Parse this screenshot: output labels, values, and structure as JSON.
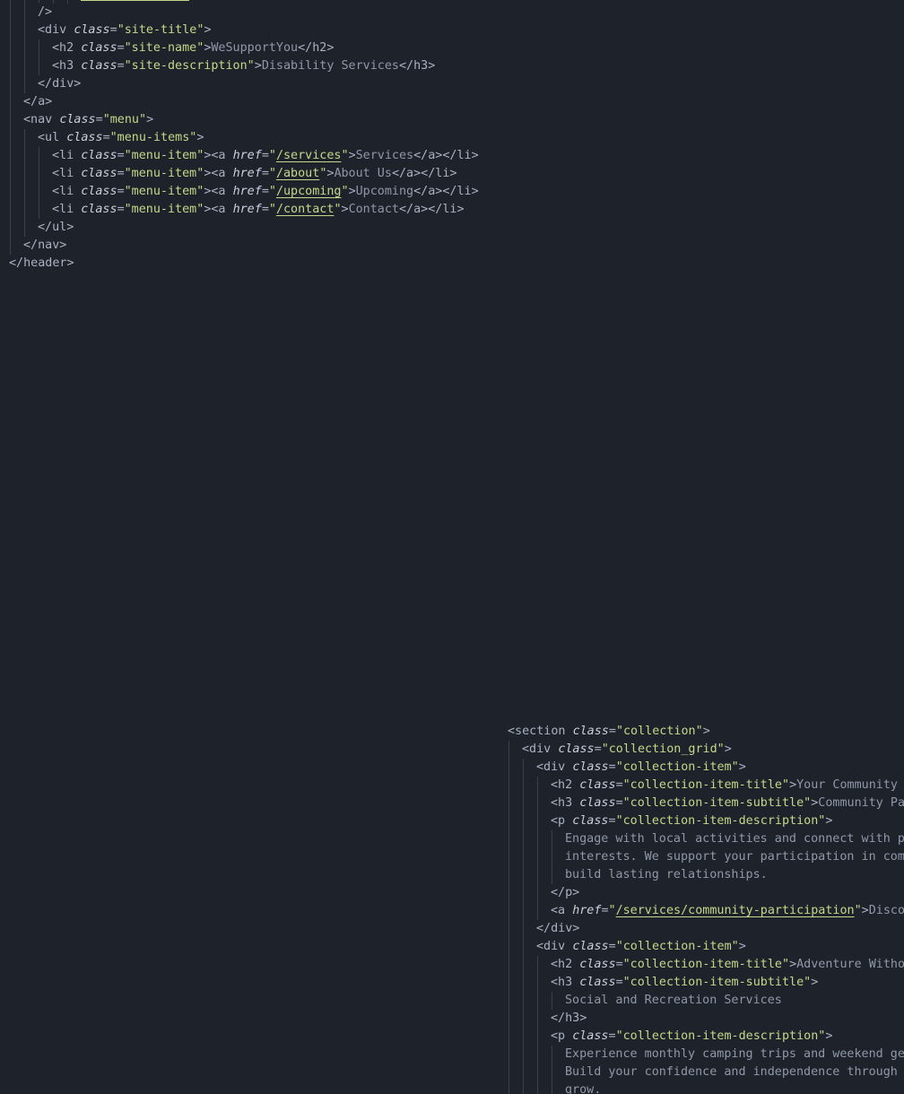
{
  "header_code": [
    {
      "indent": 5,
      "tokens": [
        {
          "k": "u",
          "v": "images/logo.svg"
        }
      ]
    },
    {
      "indent": 2,
      "tokens": [
        {
          "k": "t",
          "v": "/>"
        }
      ]
    },
    {
      "indent": 2,
      "tokens": [
        {
          "k": "t",
          "v": "<div "
        },
        {
          "k": "a",
          "v": "class"
        },
        {
          "k": "e",
          "v": "="
        },
        {
          "k": "s",
          "v": "\"site-title\""
        },
        {
          "k": "t",
          "v": ">"
        }
      ]
    },
    {
      "indent": 3,
      "tokens": [
        {
          "k": "t",
          "v": "<h2 "
        },
        {
          "k": "a",
          "v": "class"
        },
        {
          "k": "e",
          "v": "="
        },
        {
          "k": "s",
          "v": "\"site-name\""
        },
        {
          "k": "t",
          "v": ">"
        },
        {
          "k": "x",
          "v": "WeSupportYou"
        },
        {
          "k": "t",
          "v": "</h2>"
        }
      ]
    },
    {
      "indent": 3,
      "tokens": [
        {
          "k": "t",
          "v": "<h3 "
        },
        {
          "k": "a",
          "v": "class"
        },
        {
          "k": "e",
          "v": "="
        },
        {
          "k": "s",
          "v": "\"site-description\""
        },
        {
          "k": "t",
          "v": ">"
        },
        {
          "k": "x",
          "v": "Disability Services"
        },
        {
          "k": "t",
          "v": "</h3>"
        }
      ]
    },
    {
      "indent": 2,
      "tokens": [
        {
          "k": "t",
          "v": "</div>"
        }
      ]
    },
    {
      "indent": 1,
      "tokens": [
        {
          "k": "t",
          "v": "</a>"
        }
      ]
    },
    {
      "indent": 1,
      "tokens": [
        {
          "k": "t",
          "v": "<nav "
        },
        {
          "k": "a",
          "v": "class"
        },
        {
          "k": "e",
          "v": "="
        },
        {
          "k": "s",
          "v": "\"menu\""
        },
        {
          "k": "t",
          "v": ">"
        }
      ]
    },
    {
      "indent": 2,
      "tokens": [
        {
          "k": "t",
          "v": "<ul "
        },
        {
          "k": "a",
          "v": "class"
        },
        {
          "k": "e",
          "v": "="
        },
        {
          "k": "s",
          "v": "\"menu-items\""
        },
        {
          "k": "t",
          "v": ">"
        }
      ]
    },
    {
      "indent": 3,
      "tokens": [
        {
          "k": "t",
          "v": "<li "
        },
        {
          "k": "a",
          "v": "class"
        },
        {
          "k": "e",
          "v": "="
        },
        {
          "k": "s",
          "v": "\"menu-item\""
        },
        {
          "k": "t",
          "v": "><a "
        },
        {
          "k": "a",
          "v": "href"
        },
        {
          "k": "e",
          "v": "="
        },
        {
          "k": "s",
          "v": "\""
        },
        {
          "k": "u",
          "v": "/services"
        },
        {
          "k": "s",
          "v": "\""
        },
        {
          "k": "t",
          "v": ">"
        },
        {
          "k": "x",
          "v": "Services"
        },
        {
          "k": "t",
          "v": "</a></li>"
        }
      ]
    },
    {
      "indent": 3,
      "tokens": [
        {
          "k": "t",
          "v": "<li "
        },
        {
          "k": "a",
          "v": "class"
        },
        {
          "k": "e",
          "v": "="
        },
        {
          "k": "s",
          "v": "\"menu-item\""
        },
        {
          "k": "t",
          "v": "><a "
        },
        {
          "k": "a",
          "v": "href"
        },
        {
          "k": "e",
          "v": "="
        },
        {
          "k": "s",
          "v": "\""
        },
        {
          "k": "u",
          "v": "/about"
        },
        {
          "k": "s",
          "v": "\""
        },
        {
          "k": "t",
          "v": ">"
        },
        {
          "k": "x",
          "v": "About Us"
        },
        {
          "k": "t",
          "v": "</a></li>"
        }
      ]
    },
    {
      "indent": 3,
      "tokens": [
        {
          "k": "t",
          "v": "<li "
        },
        {
          "k": "a",
          "v": "class"
        },
        {
          "k": "e",
          "v": "="
        },
        {
          "k": "s",
          "v": "\"menu-item\""
        },
        {
          "k": "t",
          "v": "><a "
        },
        {
          "k": "a",
          "v": "href"
        },
        {
          "k": "e",
          "v": "="
        },
        {
          "k": "s",
          "v": "\""
        },
        {
          "k": "u",
          "v": "/upcoming"
        },
        {
          "k": "s",
          "v": "\""
        },
        {
          "k": "t",
          "v": ">"
        },
        {
          "k": "x",
          "v": "Upcoming"
        },
        {
          "k": "t",
          "v": "</a></li>"
        }
      ]
    },
    {
      "indent": 3,
      "tokens": [
        {
          "k": "t",
          "v": "<li "
        },
        {
          "k": "a",
          "v": "class"
        },
        {
          "k": "e",
          "v": "="
        },
        {
          "k": "s",
          "v": "\"menu-item\""
        },
        {
          "k": "t",
          "v": "><a "
        },
        {
          "k": "a",
          "v": "href"
        },
        {
          "k": "e",
          "v": "="
        },
        {
          "k": "s",
          "v": "\""
        },
        {
          "k": "u",
          "v": "/contact"
        },
        {
          "k": "s",
          "v": "\""
        },
        {
          "k": "t",
          "v": ">"
        },
        {
          "k": "x",
          "v": "Contact"
        },
        {
          "k": "t",
          "v": "</a></li>"
        }
      ]
    },
    {
      "indent": 2,
      "tokens": [
        {
          "k": "t",
          "v": "</ul>"
        }
      ]
    },
    {
      "indent": 1,
      "tokens": [
        {
          "k": "t",
          "v": "</nav>"
        }
      ]
    },
    {
      "indent": 0,
      "tokens": [
        {
          "k": "t",
          "v": "</header>"
        }
      ]
    }
  ],
  "collection_code": [
    {
      "indent": 0,
      "tokens": [
        {
          "k": "t",
          "v": "<section "
        },
        {
          "k": "a",
          "v": "class"
        },
        {
          "k": "e",
          "v": "="
        },
        {
          "k": "s",
          "v": "\"collection\""
        },
        {
          "k": "t",
          "v": ">"
        }
      ]
    },
    {
      "indent": 1,
      "tokens": [
        {
          "k": "t",
          "v": "<div "
        },
        {
          "k": "a",
          "v": "class"
        },
        {
          "k": "e",
          "v": "="
        },
        {
          "k": "s",
          "v": "\"collection_grid\""
        },
        {
          "k": "t",
          "v": ">"
        }
      ]
    },
    {
      "indent": 2,
      "tokens": [
        {
          "k": "t",
          "v": "<div "
        },
        {
          "k": "a",
          "v": "class"
        },
        {
          "k": "e",
          "v": "="
        },
        {
          "k": "s",
          "v": "\"collection-item\""
        },
        {
          "k": "t",
          "v": ">"
        }
      ]
    },
    {
      "indent": 3,
      "tokens": [
        {
          "k": "t",
          "v": "<h2 "
        },
        {
          "k": "a",
          "v": "class"
        },
        {
          "k": "e",
          "v": "="
        },
        {
          "k": "s",
          "v": "\"collection-item-title\""
        },
        {
          "k": "t",
          "v": ">"
        },
        {
          "k": "x",
          "v": "Your Community"
        }
      ]
    },
    {
      "indent": 3,
      "tokens": [
        {
          "k": "t",
          "v": "<h3 "
        },
        {
          "k": "a",
          "v": "class"
        },
        {
          "k": "e",
          "v": "="
        },
        {
          "k": "s",
          "v": "\"collection-item-subtitle\""
        },
        {
          "k": "t",
          "v": ">"
        },
        {
          "k": "x",
          "v": "Community Pa"
        }
      ]
    },
    {
      "indent": 3,
      "tokens": [
        {
          "k": "t",
          "v": "<p "
        },
        {
          "k": "a",
          "v": "class"
        },
        {
          "k": "e",
          "v": "="
        },
        {
          "k": "s",
          "v": "\"collection-item-description\""
        },
        {
          "k": "t",
          "v": ">"
        }
      ]
    },
    {
      "indent": 4,
      "tokens": [
        {
          "k": "x",
          "v": "Engage with local activities and connect with p"
        }
      ]
    },
    {
      "indent": 4,
      "tokens": [
        {
          "k": "x",
          "v": "interests. We support your participation in com"
        }
      ]
    },
    {
      "indent": 4,
      "tokens": [
        {
          "k": "x",
          "v": "build lasting relationships."
        }
      ]
    },
    {
      "indent": 3,
      "tokens": [
        {
          "k": "t",
          "v": "</p>"
        }
      ]
    },
    {
      "indent": 3,
      "tokens": [
        {
          "k": "t",
          "v": "<a "
        },
        {
          "k": "a",
          "v": "href"
        },
        {
          "k": "e",
          "v": "="
        },
        {
          "k": "s",
          "v": "\""
        },
        {
          "k": "u",
          "v": "/services/community-participation"
        },
        {
          "k": "s",
          "v": "\""
        },
        {
          "k": "t",
          "v": ">"
        },
        {
          "k": "x",
          "v": "Disco"
        }
      ]
    },
    {
      "indent": 2,
      "tokens": [
        {
          "k": "t",
          "v": "</div>"
        }
      ]
    },
    {
      "indent": 2,
      "tokens": [
        {
          "k": "t",
          "v": "<div "
        },
        {
          "k": "a",
          "v": "class"
        },
        {
          "k": "e",
          "v": "="
        },
        {
          "k": "s",
          "v": "\"collection-item\""
        },
        {
          "k": "t",
          "v": ">"
        }
      ]
    },
    {
      "indent": 3,
      "tokens": [
        {
          "k": "t",
          "v": "<h2 "
        },
        {
          "k": "a",
          "v": "class"
        },
        {
          "k": "e",
          "v": "="
        },
        {
          "k": "s",
          "v": "\"collection-item-title\""
        },
        {
          "k": "t",
          "v": ">"
        },
        {
          "k": "x",
          "v": "Adventure Witho"
        }
      ]
    },
    {
      "indent": 3,
      "tokens": [
        {
          "k": "t",
          "v": "<h3 "
        },
        {
          "k": "a",
          "v": "class"
        },
        {
          "k": "e",
          "v": "="
        },
        {
          "k": "s",
          "v": "\"collection-item-subtitle\""
        },
        {
          "k": "t",
          "v": ">"
        }
      ]
    },
    {
      "indent": 4,
      "tokens": [
        {
          "k": "x",
          "v": "Social and Recreation Services"
        }
      ]
    },
    {
      "indent": 3,
      "tokens": [
        {
          "k": "t",
          "v": "</h3>"
        }
      ]
    },
    {
      "indent": 3,
      "tokens": [
        {
          "k": "t",
          "v": "<p "
        },
        {
          "k": "a",
          "v": "class"
        },
        {
          "k": "e",
          "v": "="
        },
        {
          "k": "s",
          "v": "\"collection-item-description\""
        },
        {
          "k": "t",
          "v": ">"
        }
      ]
    },
    {
      "indent": 4,
      "tokens": [
        {
          "k": "x",
          "v": "Experience monthly camping trips and weekend ge"
        }
      ]
    },
    {
      "indent": 4,
      "tokens": [
        {
          "k": "x",
          "v": "Build your confidence and independence through "
        }
      ]
    },
    {
      "indent": 4,
      "tokens": [
        {
          "k": "x",
          "v": "grow."
        }
      ]
    }
  ],
  "colors": {
    "background": "#1e222a",
    "tag": "#a9b2c3",
    "attribute": "#c9d1df",
    "string": "#c3d88a",
    "text": "#8f98aa",
    "indent_guide": "#3a404c"
  }
}
